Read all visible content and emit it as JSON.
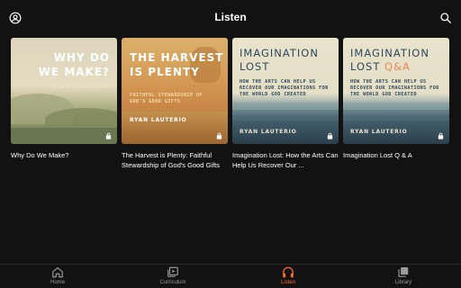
{
  "header": {
    "title": "Listen",
    "left_icon": "account-circle-icon",
    "right_icon": "search-icon"
  },
  "cards": [
    {
      "title": "Why Do We Make?",
      "cover_title_line1": "WHY DO",
      "cover_title_line2": "WE MAKE?",
      "cover_author": "RYAN LAUTERIO",
      "locked": true
    },
    {
      "title": "The Harvest is Plenty: Faithful Stewardship of God's Good Gifts",
      "cover_title_line1": "THE HARVEST",
      "cover_title_line2": "IS PLENTY",
      "cover_subtitle_line1": "FAITHFUL STEWARDSHIP OF",
      "cover_subtitle_line2": "GOD'S GOOD GIFTS",
      "cover_author": "RYAN LAUTERIO",
      "locked": true
    },
    {
      "title": "Imagination Lost: How the Arts Can Help Us Recover Our ...",
      "cover_title_line1": "IMAGINATION",
      "cover_title_line2": "LOST",
      "cover_subtitle_line1": "HOW THE ARTS CAN HELP US",
      "cover_subtitle_line2": "RECOVER OUR IMAGINATIONS FOR",
      "cover_subtitle_line3": "THE WORLD GOD CREATED",
      "cover_author": "RYAN LAUTERIO",
      "locked": true
    },
    {
      "title": "Imagination Lost Q & A",
      "cover_title_line1": "IMAGINATION",
      "cover_title_line2a": "LOST ",
      "cover_title_line2b": "Q&A",
      "cover_subtitle_line1": "HOW THE ARTS CAN HELP US",
      "cover_subtitle_line2": "RECOVER OUR IMAGINATIONS FOR",
      "cover_subtitle_line3": "THE WORLD GOD CREATED",
      "cover_author": "RYAN LAUTERIO",
      "locked": true
    }
  ],
  "nav": {
    "items": [
      {
        "label": "Home",
        "icon": "home-icon",
        "active": false
      },
      {
        "label": "Curriculum",
        "icon": "curriculum-icon",
        "active": false
      },
      {
        "label": "Listen",
        "icon": "headphones-icon",
        "active": true
      },
      {
        "label": "Library",
        "icon": "library-icon",
        "active": false
      }
    ]
  },
  "colors": {
    "background": "#121212",
    "accent": "#ff6a2b",
    "inactive_nav": "#9a9a9a",
    "q_and_a_accent": "#e58a53"
  }
}
